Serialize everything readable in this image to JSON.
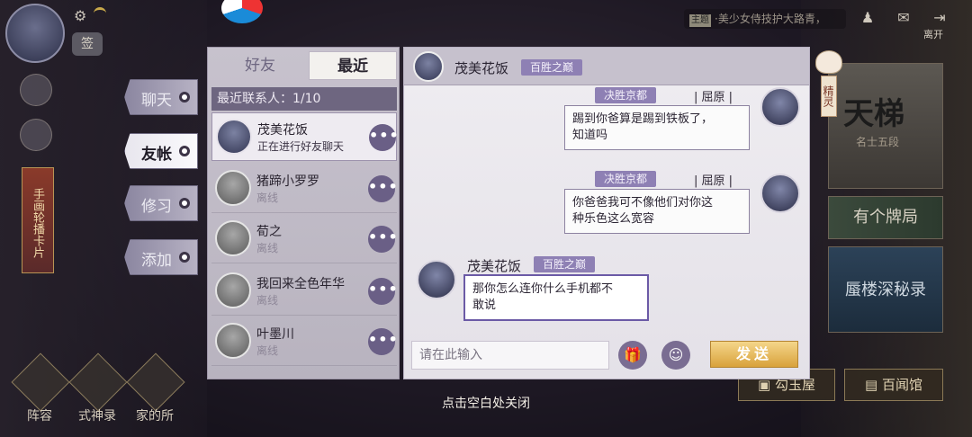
{
  "colors": {
    "accent": "#8e80b4",
    "send": "#d9a23c",
    "highlight": "#6b5aa6"
  },
  "topbar": {
    "seal_label": "签",
    "marquee_tag": "主题",
    "marquee_text": "·美少女侍技护大路青，",
    "leave_label": "离开"
  },
  "left_banner": "手画轮播卡片",
  "bottom_menu": [
    {
      "label": "阵容",
      "icon": "team-icon"
    },
    {
      "label": "式神录",
      "icon": "shikigami-icon"
    },
    {
      "label": "家的所",
      "icon": "home-icon"
    }
  ],
  "right_column": {
    "tianti_title": "天梯",
    "tianti_sub": "名士五段",
    "card_mid": "有个牌局",
    "card_blue": "蜃楼深秘录",
    "btn_shop": "勾玉屋",
    "btn_library": "百闻馆"
  },
  "elf_label": "精灵",
  "nav_tabs": [
    {
      "label": "聊天",
      "active": false
    },
    {
      "label": "友帐",
      "active": true
    },
    {
      "label": "修习",
      "active": false
    },
    {
      "label": "添加",
      "active": false
    }
  ],
  "list": {
    "tab_friends": "好友",
    "tab_recent": "最近",
    "header": "最近联系人：1/10",
    "contacts": [
      {
        "name": "茂美花饭",
        "status": "正在进行好友聊天"
      },
      {
        "name": "猪蹄小罗罗",
        "status": "离线"
      },
      {
        "name": "荀之",
        "status": "离线"
      },
      {
        "name": "我回来全色年华",
        "status": "离线"
      },
      {
        "name": "叶墨川",
        "status": "离线"
      }
    ],
    "more_label": "•••"
  },
  "chat": {
    "partner_name": "茂美花饭",
    "partner_badge": "百胜之巅",
    "messages": [
      {
        "side": "right",
        "badge": "决胜京都",
        "name": "屈原",
        "text_line1": "踢到你爸算是踢到铁板了，",
        "text_line2": "知道吗"
      },
      {
        "side": "right",
        "badge": "决胜京都",
        "name": "屈原",
        "text_line1": "你爸爸我可不像他们对你这",
        "text_line2": "种乐色这么宽容"
      },
      {
        "side": "left",
        "badge": "百胜之巅",
        "name": "茂美花饭",
        "text_line1": "那你怎么连你什么手机都不",
        "text_line2": "敢说"
      }
    ],
    "input_placeholder": "请在此输入",
    "send_label": "发送"
  },
  "close_hint": "点击空白处关闭"
}
